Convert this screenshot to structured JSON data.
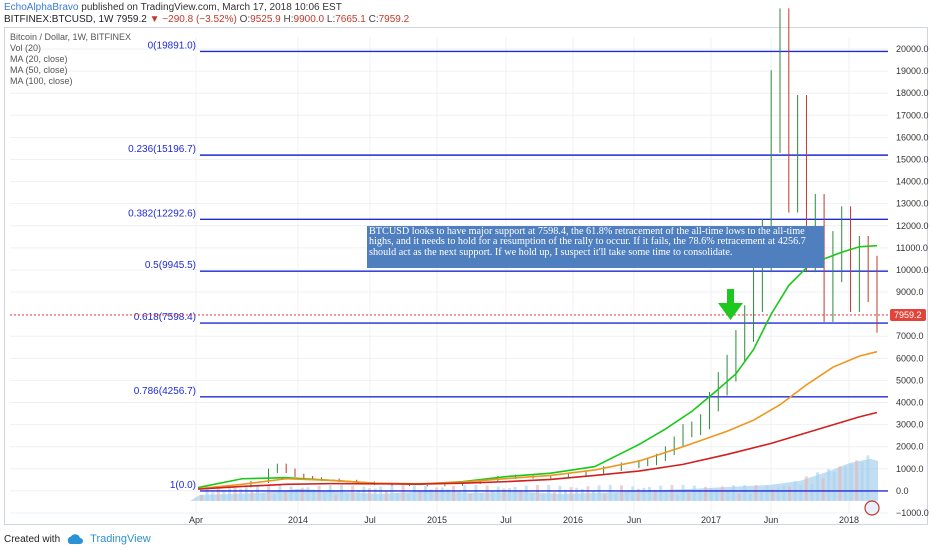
{
  "header": {
    "author": "EchoAlphaBravo",
    "published": "published on TradingView.com, March 17, 2018 10:06 EST"
  },
  "quote": {
    "symbol": "BITFINEX:BTCUSD, 1W",
    "last": "7959.2",
    "change": "−290.8 (−3.52%)",
    "o_label": "O:",
    "o": "9525.9",
    "h_label": "H:",
    "h": "9900.0",
    "l_label": "L:",
    "l": "7665.1",
    "c_label": "C:",
    "c": "7959.2"
  },
  "pane": {
    "title": "Bitcoin / Dollar, 1W, BITFINEX",
    "indicators": [
      "Vol (20)",
      "MA (20, close)",
      "MA (50, close)",
      "MA (100, close)"
    ]
  },
  "annotation": "BTCUSD looks to have major support at 7598.4, the 61.8% retracement of the all-time lows to the all-time highs, and it needs to hold for a resumption of the rally to occur. If it fails, the 78.6% retracement at 4256.7 should act as the next support. If we hold up, I suspect it'll take some time to consolidate.",
  "footer": {
    "created_with": "Created with",
    "brand": "TradingView"
  },
  "colors": {
    "fib": "#1f2bd8",
    "ma20": "#19c819",
    "ma50": "#f0951e",
    "ma100": "#d02020",
    "price_up": "#2c8a3a",
    "price_down": "#c0392b",
    "volume": "#8fc3e8",
    "arrow": "#1ec81e",
    "annotation_bg": "#4f7fbf",
    "price_tag": "#e0443a"
  },
  "chart_data": {
    "type": "line",
    "title": "Bitcoin / Dollar, 1W, BITFINEX",
    "x_ticks": [
      "Apr",
      "2014",
      "Jul",
      "2015",
      "Jul",
      "2016",
      "Jun",
      "2017",
      "Jun",
      "2018"
    ],
    "y_ticks": [
      "20000.0",
      "19000.0",
      "18000.0",
      "17000.0",
      "16000.0",
      "15000.0",
      "14000.0",
      "13000.0",
      "12000.0",
      "11000.0",
      "10000.0",
      "9000.0",
      "8000.0",
      "7000.0",
      "6000.0",
      "5000.0",
      "4000.0",
      "3000.0",
      "2000.0",
      "1000.0",
      "0.0",
      "−1000.0"
    ],
    "ylim": [
      -1000,
      20500
    ],
    "last_price": 7959.2,
    "last_price_label": "7959.2",
    "fib_levels": [
      {
        "label": "0(19891.0)",
        "value": 19891.0
      },
      {
        "label": "0.236(15196.7)",
        "value": 15196.7
      },
      {
        "label": "0.382(12292.6)",
        "value": 12292.6
      },
      {
        "label": "0.5(9945.5)",
        "value": 9945.5
      },
      {
        "label": "0.618(7598.4)",
        "value": 7598.4
      },
      {
        "label": "0.786(4256.7)",
        "value": 4256.7
      },
      {
        "label": "1(0.0)",
        "value": 0.0
      }
    ],
    "series": [
      {
        "name": "MA (20, close)",
        "x": [
          0,
          5,
          10,
          15,
          20,
          25,
          30,
          35,
          40,
          45,
          50,
          53,
          56,
          59,
          61,
          63,
          65,
          67,
          69,
          71,
          73,
          75,
          77
        ],
        "y": [
          150,
          550,
          600,
          480,
          350,
          300,
          420,
          650,
          800,
          1100,
          2100,
          2800,
          3600,
          4600,
          5300,
          6400,
          8000,
          9300,
          10100,
          10500,
          10800,
          11050,
          11100
        ]
      },
      {
        "name": "MA (50, close)",
        "x": [
          0,
          5,
          10,
          15,
          20,
          25,
          30,
          35,
          40,
          45,
          50,
          55,
          60,
          63,
          66,
          69,
          72,
          75,
          77
        ],
        "y": [
          100,
          300,
          550,
          480,
          350,
          320,
          400,
          560,
          700,
          950,
          1350,
          2000,
          2700,
          3200,
          3900,
          4800,
          5600,
          6100,
          6300
        ]
      },
      {
        "name": "MA (100, close)",
        "x": [
          0,
          5,
          10,
          15,
          20,
          25,
          30,
          35,
          40,
          45,
          50,
          55,
          60,
          65,
          70,
          75,
          77
        ],
        "y": [
          80,
          200,
          300,
          330,
          320,
          310,
          350,
          420,
          520,
          700,
          900,
          1200,
          1650,
          2150,
          2750,
          3350,
          3550
        ]
      }
    ],
    "price": {
      "x": [
        0,
        2,
        4,
        6,
        8,
        9,
        10,
        11,
        12,
        13,
        14,
        16,
        18,
        20,
        22,
        24,
        26,
        28,
        30,
        32,
        34,
        36,
        38,
        40,
        42,
        44,
        46,
        48,
        50,
        51,
        52,
        53,
        54,
        55,
        56,
        57,
        58,
        59,
        60,
        61,
        62,
        63,
        64,
        65,
        66,
        67,
        68,
        69,
        70,
        71,
        72,
        73,
        74,
        75,
        76,
        77
      ],
      "y": [
        120,
        140,
        180,
        400,
        900,
        1100,
        900,
        700,
        600,
        550,
        500,
        450,
        380,
        300,
        260,
        240,
        230,
        260,
        350,
        450,
        600,
        650,
        620,
        650,
        720,
        800,
        1000,
        1150,
        1250,
        1300,
        1500,
        1800,
        2200,
        2700,
        2800,
        3100,
        4000,
        4800,
        5500,
        6500,
        7500,
        9000,
        11000,
        17000,
        19500,
        14000,
        16000,
        11000,
        12000,
        8500,
        10500,
        11500,
        9000,
        10300,
        9500,
        7959
      ]
    },
    "volume_note": "Vol (20)"
  }
}
